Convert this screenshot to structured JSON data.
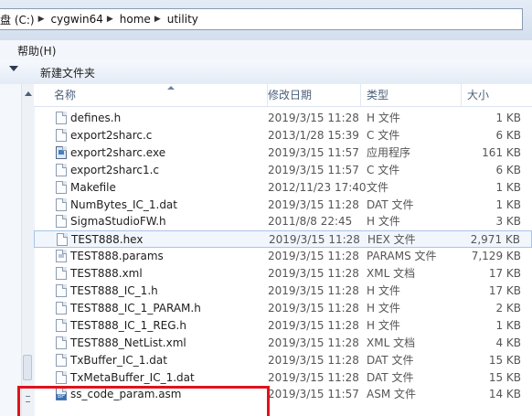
{
  "address": {
    "crumbs": [
      "盘 (C:)",
      "cygwin64",
      "home",
      "utility"
    ]
  },
  "menu": {
    "help_label": "帮助(H)"
  },
  "toolbar": {
    "new_folder_label": "新建文件夹"
  },
  "columns": {
    "name": "名称",
    "date": "修改日期",
    "type": "类型",
    "size": "大小"
  },
  "files": [
    {
      "name": "defines.h",
      "date": "2019/3/15 11:28",
      "type": "H 文件",
      "size": "1 KB",
      "icon": "text-file-icon"
    },
    {
      "name": "export2sharc.c",
      "date": "2013/1/28 15:39",
      "type": "C 文件",
      "size": "6 KB",
      "icon": "text-file-icon"
    },
    {
      "name": "export2sharc.exe",
      "date": "2019/3/15 11:57",
      "type": "应用程序",
      "size": "161 KB",
      "icon": "exe-file-icon"
    },
    {
      "name": "export2sharc1.c",
      "date": "2019/3/15 11:57",
      "type": "C 文件",
      "size": "6 KB",
      "icon": "text-file-icon"
    },
    {
      "name": "Makefile",
      "date": "2012/11/23 17:40",
      "type": "文件",
      "size": "1 KB",
      "icon": "text-file-icon"
    },
    {
      "name": "NumBytes_IC_1.dat",
      "date": "2019/3/15 11:28",
      "type": "DAT 文件",
      "size": "1 KB",
      "icon": "text-file-icon"
    },
    {
      "name": "SigmaStudioFW.h",
      "date": "2011/8/8 22:45",
      "type": "H 文件",
      "size": "3 KB",
      "icon": "text-file-icon"
    },
    {
      "name": "TEST888.hex",
      "date": "2019/3/15 11:28",
      "type": "HEX 文件",
      "size": "2,971 KB",
      "icon": "text-file-icon"
    },
    {
      "name": "TEST888.params",
      "date": "2019/3/15 11:28",
      "type": "PARAMS 文件",
      "size": "7,129 KB",
      "icon": "params-file-icon"
    },
    {
      "name": "TEST888.xml",
      "date": "2019/3/15 11:28",
      "type": "XML 文档",
      "size": "17 KB",
      "icon": "text-file-icon"
    },
    {
      "name": "TEST888_IC_1.h",
      "date": "2019/3/15 11:28",
      "type": "H 文件",
      "size": "17 KB",
      "icon": "text-file-icon"
    },
    {
      "name": "TEST888_IC_1_PARAM.h",
      "date": "2019/3/15 11:28",
      "type": "H 文件",
      "size": "2 KB",
      "icon": "text-file-icon"
    },
    {
      "name": "TEST888_IC_1_REG.h",
      "date": "2019/3/15 11:28",
      "type": "H 文件",
      "size": "1 KB",
      "icon": "text-file-icon"
    },
    {
      "name": "TEST888_NetList.xml",
      "date": "2019/3/15 11:28",
      "type": "XML 文档",
      "size": "4 KB",
      "icon": "text-file-icon"
    },
    {
      "name": "TxBuffer_IC_1.dat",
      "date": "2019/3/15 11:28",
      "type": "DAT 文件",
      "size": "15 KB",
      "icon": "text-file-icon"
    },
    {
      "name": "TxMetaBuffer_IC_1.dat",
      "date": "2019/3/15 11:28",
      "type": "DAT 文件",
      "size": "15 KB",
      "icon": "text-file-icon"
    },
    {
      "name": "ss_code_param.asm",
      "date": "2019/3/15 11:57",
      "type": "ASM 文件",
      "size": "14 KB",
      "icon": "asm-file-icon"
    }
  ],
  "selected_file": "TEST888.hex",
  "highlighted_file": "ss_code_param.asm",
  "colors": {
    "highlight_box": "#e0121b",
    "selection_border": "#a7c4e8"
  }
}
